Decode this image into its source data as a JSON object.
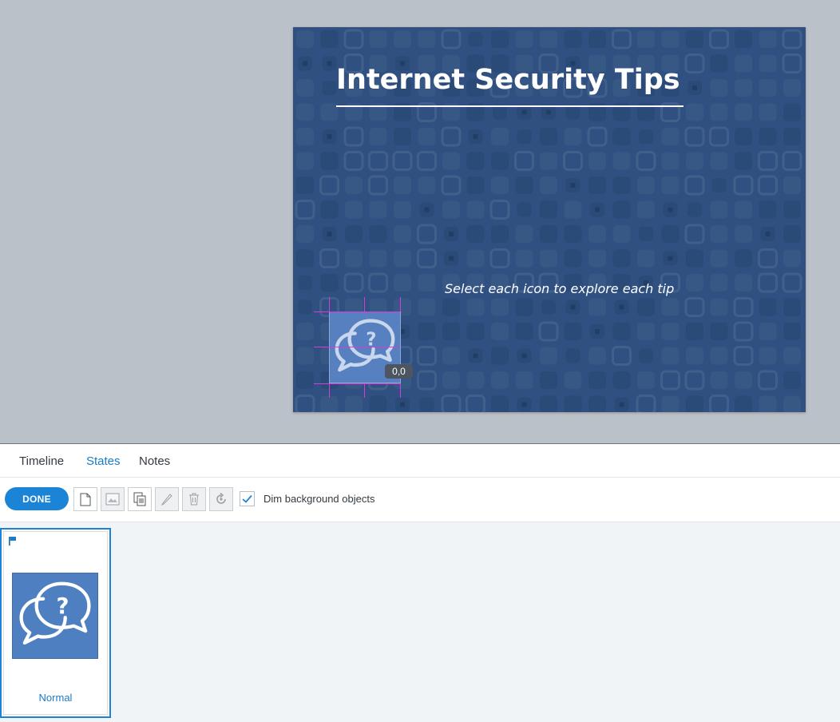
{
  "slide": {
    "title": "Internet Security Tips",
    "instruction": "Select each icon to explore each tip",
    "object": {
      "icon": "chat-question-icon",
      "coordinate_badge": "0,0"
    }
  },
  "panel": {
    "tabs": [
      {
        "label": "Timeline",
        "active": false
      },
      {
        "label": "States",
        "active": true
      },
      {
        "label": "Notes",
        "active": false
      }
    ],
    "toolbar": {
      "done_label": "DONE",
      "tools": [
        {
          "name": "new-state-icon",
          "enabled": true
        },
        {
          "name": "image-state-icon",
          "enabled": false
        },
        {
          "name": "duplicate-state-icon",
          "enabled": true
        },
        {
          "name": "edit-state-icon",
          "enabled": false
        },
        {
          "name": "delete-state-icon",
          "enabled": false
        },
        {
          "name": "reset-state-icon",
          "enabled": false
        }
      ],
      "dim_checkbox": {
        "label": "Dim background objects",
        "checked": true
      }
    },
    "states": [
      {
        "label": "Normal",
        "icon": "chat-question-icon",
        "selected": true
      }
    ]
  },
  "colors": {
    "slide_bg": "#2f5080",
    "accent": "#1b84d6",
    "object_fill": "#5680bf",
    "guide": "#d83ad8"
  }
}
